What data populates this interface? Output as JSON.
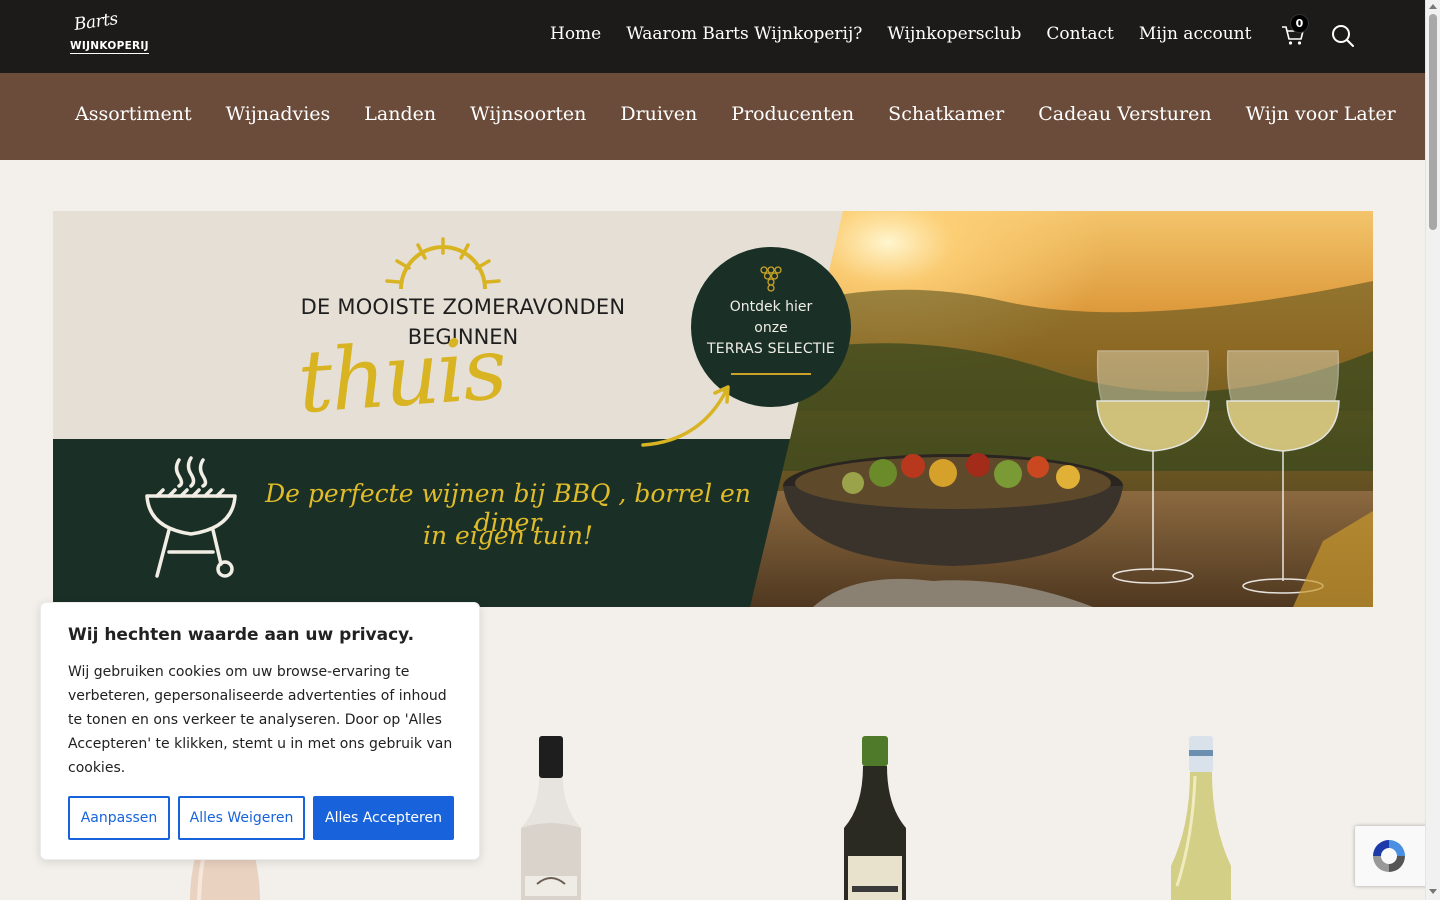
{
  "header": {
    "logo_script": "Barts",
    "logo_word": "WIJNKOPERIJ",
    "nav": [
      "Home",
      "Waarom Barts Wijnkoperij?",
      "Wijnkopersclub",
      "Contact",
      "Mijn account"
    ],
    "cart_count": "0"
  },
  "main_nav": [
    "Assortiment",
    "Wijnadvies",
    "Landen",
    "Wijnsoorten",
    "Druiven",
    "Producenten",
    "Schatkamer",
    "Cadeau Versturen",
    "Wijn voor Later"
  ],
  "banner": {
    "headline_1": "DE MOOISTE ZOMERAVONDEN",
    "headline_2": "BEGINNEN",
    "script_word": "thuis",
    "circle_line_1": "Ontdek hier",
    "circle_line_2": "onze",
    "circle_line_3": "TERRAS SELECTIE",
    "tagline_1": "De perfecte wijnen bij BBQ , borrel en diner",
    "tagline_2": "in eigen tuin!"
  },
  "cookie": {
    "title": "Wij hechten waarde aan uw privacy.",
    "text": "Wij gebruiken cookies om uw browse-ervaring te verbeteren, gepersonaliseerde advertenties of inhoud te tonen en ons verkeer te analyseren. Door op 'Alles Accepteren' te klikken, stemt u in met ons gebruik van cookies.",
    "btn_customize": "Aanpassen",
    "btn_reject": "Alles Weigeren",
    "btn_accept": "Alles Accepteren"
  },
  "colors": {
    "topbar": "#1c1b1a",
    "mainnav": "#6b4c3b",
    "page_bg": "#f3efeb",
    "accent_gold": "#d8b322",
    "dark_green": "#1a3026",
    "cookie_blue": "#1863dc"
  },
  "icons": [
    "cart-icon",
    "search-icon",
    "sun-icon",
    "grape-icon",
    "arrow-icon",
    "bbq-grill-icon",
    "recaptcha-icon"
  ]
}
